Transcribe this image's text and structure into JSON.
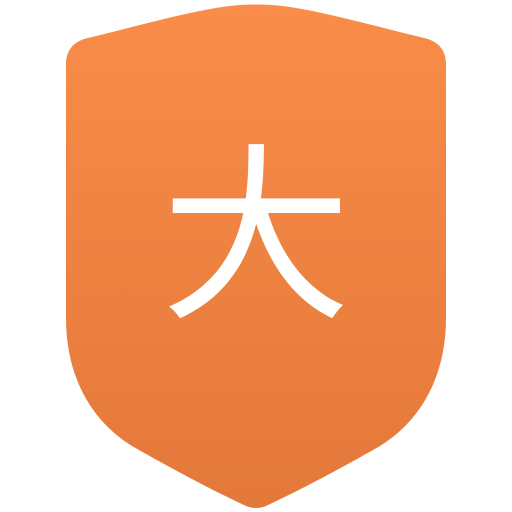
{
  "badge": {
    "glyph": "大",
    "icon": "shield-icon",
    "colors": {
      "top": "#F98C48",
      "bottom": "#E3783A",
      "glyph": "#FFFFFF"
    }
  }
}
